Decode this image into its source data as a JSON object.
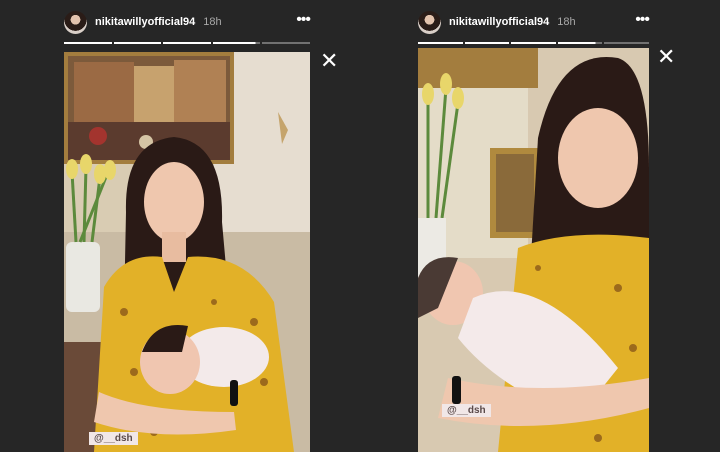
{
  "stories": [
    {
      "username": "nikitawillyofficial94",
      "time": "18h",
      "more_label": "•••",
      "mention": "@__dsh",
      "progress": [
        1,
        1,
        1,
        0.9,
        0
      ],
      "close_label": "✕"
    },
    {
      "username": "nikitawillyofficial94",
      "time": "18h",
      "more_label": "•••",
      "mention": "@__dsh",
      "progress": [
        1,
        1,
        1,
        0.85,
        0
      ],
      "close_label": "✕"
    }
  ],
  "colors": {
    "background": "#262626",
    "dress": "#e2b128",
    "hair": "#2a1a16",
    "skin": "#efc7ae",
    "tulip": "#e8d66a",
    "frame_gold": "#a37d3e"
  }
}
